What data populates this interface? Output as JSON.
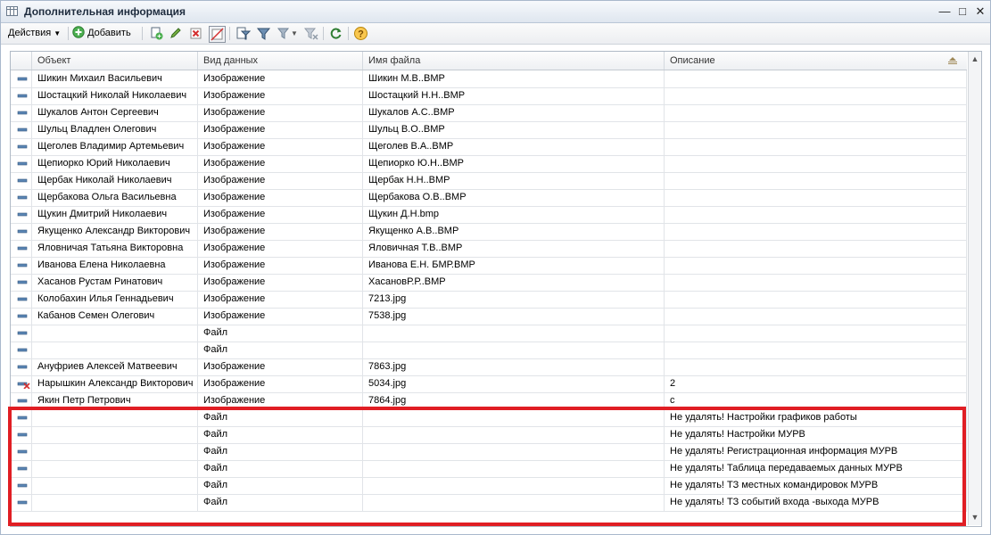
{
  "window": {
    "title": "Дополнительная информация"
  },
  "toolbar": {
    "actions_label": "Действия",
    "add_label": "Добавить"
  },
  "columns": [
    "Объект",
    "Вид данных",
    "Имя файла",
    "Описание"
  ],
  "rows": [
    {
      "icon": "record-icon",
      "object": "Шикин Михаил Васильевич",
      "type": "Изображение",
      "file": "Шикин М.В..BMP",
      "desc": ""
    },
    {
      "icon": "record-icon",
      "object": "Шостацкий Николай Николаевич",
      "type": "Изображение",
      "file": "Шостацкий Н.Н..BMP",
      "desc": ""
    },
    {
      "icon": "record-icon",
      "object": "Шукалов Антон Сергеевич",
      "type": "Изображение",
      "file": "Шукалов А.С..BMP",
      "desc": ""
    },
    {
      "icon": "record-icon",
      "object": "Шульц Владлен Олегович",
      "type": "Изображение",
      "file": "Шульц В.О..BMP",
      "desc": ""
    },
    {
      "icon": "record-icon",
      "object": "Щеголев Владимир Артемьевич",
      "type": "Изображение",
      "file": "Щеголев В.А..BMP",
      "desc": ""
    },
    {
      "icon": "record-icon",
      "object": "Щепиорко Юрий Николаевич",
      "type": "Изображение",
      "file": "Щепиорко Ю.Н..BMP",
      "desc": ""
    },
    {
      "icon": "record-icon",
      "object": "Щербак Николай Николаевич",
      "type": "Изображение",
      "file": "Щербак Н.Н..BMP",
      "desc": ""
    },
    {
      "icon": "record-icon",
      "object": "Щербакова Ольга Васильевна",
      "type": "Изображение",
      "file": "Щербакова О.В..BMP",
      "desc": ""
    },
    {
      "icon": "record-icon",
      "object": "Щукин Дмитрий Николаевич",
      "type": "Изображение",
      "file": "Щукин Д.Н.bmp",
      "desc": ""
    },
    {
      "icon": "record-icon",
      "object": "Якущенко Александр Викторович",
      "type": "Изображение",
      "file": "Якущенко А.В..BMP",
      "desc": ""
    },
    {
      "icon": "record-icon",
      "object": "Яловничая Татьяна Викторовна",
      "type": "Изображение",
      "file": "Яловичная Т.В..BMP",
      "desc": ""
    },
    {
      "icon": "record-icon",
      "object": "Иванова Елена Николаевна",
      "type": "Изображение",
      "file": "Иванова Е.Н. БМР.BMP",
      "desc": ""
    },
    {
      "icon": "record-icon",
      "object": "Хасанов Рустам Ринатович",
      "type": "Изображение",
      "file": "ХасановР.Р..BMP",
      "desc": ""
    },
    {
      "icon": "record-icon",
      "object": "Колобахин Илья Геннадьевич",
      "type": "Изображение",
      "file": "7213.jpg",
      "desc": ""
    },
    {
      "icon": "record-icon",
      "object": "Кабанов Семен Олегович",
      "type": "Изображение",
      "file": "7538.jpg",
      "desc": ""
    },
    {
      "icon": "record-icon",
      "object": "",
      "type": "Файл",
      "file": "",
      "desc": ""
    },
    {
      "icon": "record-icon",
      "object": "",
      "type": "Файл",
      "file": "",
      "desc": ""
    },
    {
      "icon": "record-icon",
      "object": "Ануфриев Алексей Матвеевич",
      "type": "Изображение",
      "file": "7863.jpg",
      "desc": ""
    },
    {
      "icon": "deleted-record-icon",
      "object": "Нарышкин Александр Викторович",
      "type": "Изображение",
      "file": "5034.jpg",
      "desc": "2"
    },
    {
      "icon": "record-icon",
      "object": "Якин Петр Петрович",
      "type": "Изображение",
      "file": "7864.jpg",
      "desc": "c"
    },
    {
      "icon": "record-icon",
      "object": "",
      "type": "Файл",
      "file": "",
      "desc": "Не удалять! Настройки графиков работы"
    },
    {
      "icon": "record-icon",
      "object": "",
      "type": "Файл",
      "file": "",
      "desc": "Не удалять! Настройки МУРВ"
    },
    {
      "icon": "record-icon",
      "object": "",
      "type": "Файл",
      "file": "",
      "desc": "Не удалять! Регистрационная информация МУРВ"
    },
    {
      "icon": "record-icon",
      "object": "",
      "type": "Файл",
      "file": "",
      "desc": "Не удалять! Таблица передаваемых данных МУРВ"
    },
    {
      "icon": "record-icon",
      "object": "",
      "type": "Файл",
      "file": "",
      "desc": "Не удалять! ТЗ местных командировок МУРВ"
    },
    {
      "icon": "record-icon",
      "object": "",
      "type": "Файл",
      "file": "",
      "desc": "Не удалять! ТЗ событий входа -выхода МУРВ"
    }
  ],
  "colors": {
    "highlight": "#e01e24",
    "accent": "#1d2b3d"
  }
}
